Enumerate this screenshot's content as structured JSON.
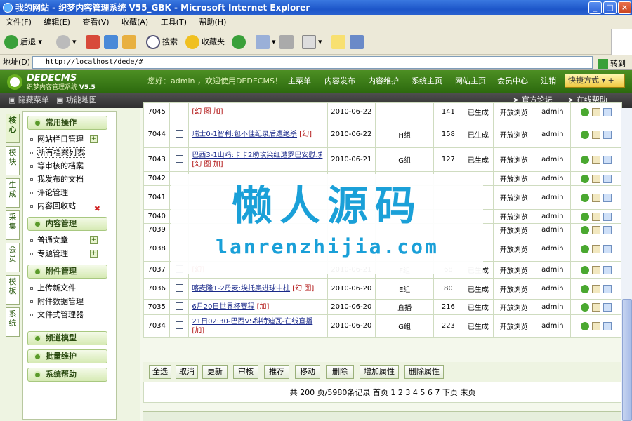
{
  "window": {
    "title": "我的网站 - 织梦内容管理系统 V55_GBK - Microsoft Internet Explorer"
  },
  "menubar": [
    "文件(F)",
    "编辑(E)",
    "查看(V)",
    "收藏(A)",
    "工具(T)",
    "帮助(H)"
  ],
  "toolbar": {
    "back": "后退",
    "search": "搜索",
    "favorites": "收藏夹"
  },
  "address": {
    "label": "地址(D)",
    "url": "http://localhost/dede/#",
    "go": "转到"
  },
  "dede": {
    "logo": "DEDECMS",
    "logo_sub": "织梦内容管理系统",
    "version": "V5.5",
    "hello": "您好：admin ，欢迎使用DEDECMS！",
    "nav": [
      "主菜单",
      "内容发布",
      "内容维护",
      "系统主页",
      "网站主页",
      "会员中心",
      "注销"
    ],
    "quick": "快捷方式"
  },
  "subbar": {
    "hide_menu": "隐藏菜单",
    "site_map": "功能地图",
    "forum": "官方论坛",
    "help": "在线帮助"
  },
  "vtabs": [
    "核心",
    "模块",
    "生成",
    "采集",
    "会员",
    "模板",
    "系统"
  ],
  "leftmenu": [
    {
      "title": "常用操作",
      "items": [
        {
          "label": "网站栏目管理",
          "icon": "plus"
        },
        {
          "label": "所有档案列表",
          "icon": "",
          "selected": true
        },
        {
          "label": "等审核的档案",
          "icon": ""
        },
        {
          "label": "我发布的文档",
          "icon": ""
        },
        {
          "label": "评论管理",
          "icon": ""
        },
        {
          "label": "内容回收站",
          "icon": "delete"
        }
      ]
    },
    {
      "title": "内容管理",
      "items": [
        {
          "label": "普通文章",
          "icon": "plus"
        },
        {
          "label": "专题管理",
          "icon": "plus"
        }
      ]
    },
    {
      "title": "附件管理",
      "items": [
        {
          "label": "上传新文件",
          "icon": ""
        },
        {
          "label": "附件数据管理",
          "icon": ""
        },
        {
          "label": "文件式管理器",
          "icon": ""
        }
      ]
    },
    {
      "title": "频道模型",
      "items": []
    },
    {
      "title": "批量维护",
      "items": []
    },
    {
      "title": "系统帮助",
      "items": []
    }
  ],
  "rows": [
    {
      "id": "7045",
      "checkbox": false,
      "title": "",
      "tags": [
        "幻",
        "图",
        "加"
      ],
      "date": "2010-06-22",
      "group": "",
      "clicks": "141",
      "status": "已生成",
      "publish": "开放浏览",
      "author": "admin"
    },
    {
      "id": "7044",
      "checkbox": true,
      "title": "瑞士0-1智利:包不佳纪录后遭绝杀",
      "tags": [
        "幻"
      ],
      "date": "2010-06-22",
      "group": "H组",
      "clicks": "158",
      "status": "已生成",
      "publish": "开放浏览",
      "author": "admin"
    },
    {
      "id": "7043",
      "checkbox": true,
      "title": "巴西3-1山鸡:卡卡2助攻染红遭罗巴安慰球",
      "tags": [
        "幻",
        "图",
        "加"
      ],
      "date": "2010-06-21",
      "group": "G组",
      "clicks": "127",
      "status": "已生成",
      "publish": "开放浏览",
      "author": "admin"
    },
    {
      "id": "7042",
      "checkbox": false,
      "title": "",
      "tags": [],
      "date": "",
      "group": "",
      "clicks": "",
      "status": "",
      "publish": "开放浏览",
      "author": "admin"
    },
    {
      "id": "7041",
      "checkbox": false,
      "title": "",
      "tags": [],
      "date": "",
      "group": "",
      "clicks": "",
      "status": "",
      "publish": "开放浏览",
      "author": "admin"
    },
    {
      "id": "7040",
      "checkbox": false,
      "title": "",
      "tags": [],
      "date": "",
      "group": "",
      "clicks": "",
      "status": "",
      "publish": "开放浏览",
      "author": "admin"
    },
    {
      "id": "7039",
      "checkbox": false,
      "title": "",
      "tags": [],
      "date": "",
      "group": "",
      "clicks": "",
      "status": "",
      "publish": "开放浏览",
      "author": "admin"
    },
    {
      "id": "7038",
      "checkbox": false,
      "title": "",
      "tags": [],
      "date": "",
      "group": "",
      "clicks": "",
      "status": "",
      "publish": "开放浏览",
      "author": "admin"
    },
    {
      "id": "7037",
      "checkbox": true,
      "title": "",
      "tags": [
        "幻"
      ],
      "date": "2010-06-21",
      "group": "F组",
      "clicks": "68",
      "status": "已生成",
      "publish": "开放浏览",
      "author": "admin"
    },
    {
      "id": "7036",
      "checkbox": true,
      "title": "喀麦隆1-2丹麦:埃托奥进球中柱",
      "tags": [
        "幻",
        "图"
      ],
      "date": "2010-06-20",
      "group": "E组",
      "clicks": "80",
      "status": "已生成",
      "publish": "开放浏览",
      "author": "admin"
    },
    {
      "id": "7035",
      "checkbox": true,
      "title": "6月20日世界杯赛程",
      "tags": [
        "加"
      ],
      "date": "2010-06-20",
      "group": "直播",
      "clicks": "216",
      "status": "已生成",
      "publish": "开放浏览",
      "author": "admin"
    },
    {
      "id": "7034",
      "checkbox": true,
      "title": "21日02:30-巴西VS科特迪瓦-在线直播",
      "tags": [
        "加"
      ],
      "date": "2010-06-20",
      "group": "G组",
      "clicks": "223",
      "status": "已生成",
      "publish": "开放浏览",
      "author": "admin"
    }
  ],
  "buttons": [
    "全选",
    "取消",
    "更新",
    "审核",
    "推荐",
    "移动",
    "删除",
    "增加属性",
    "删除属性"
  ],
  "pager": "共 200 页/5980条记录 首页 1 2 3 4 5 6 7 下页 末页",
  "watermark": {
    "cn": "懒人源码",
    "en": "lanrenzhijia.com"
  }
}
